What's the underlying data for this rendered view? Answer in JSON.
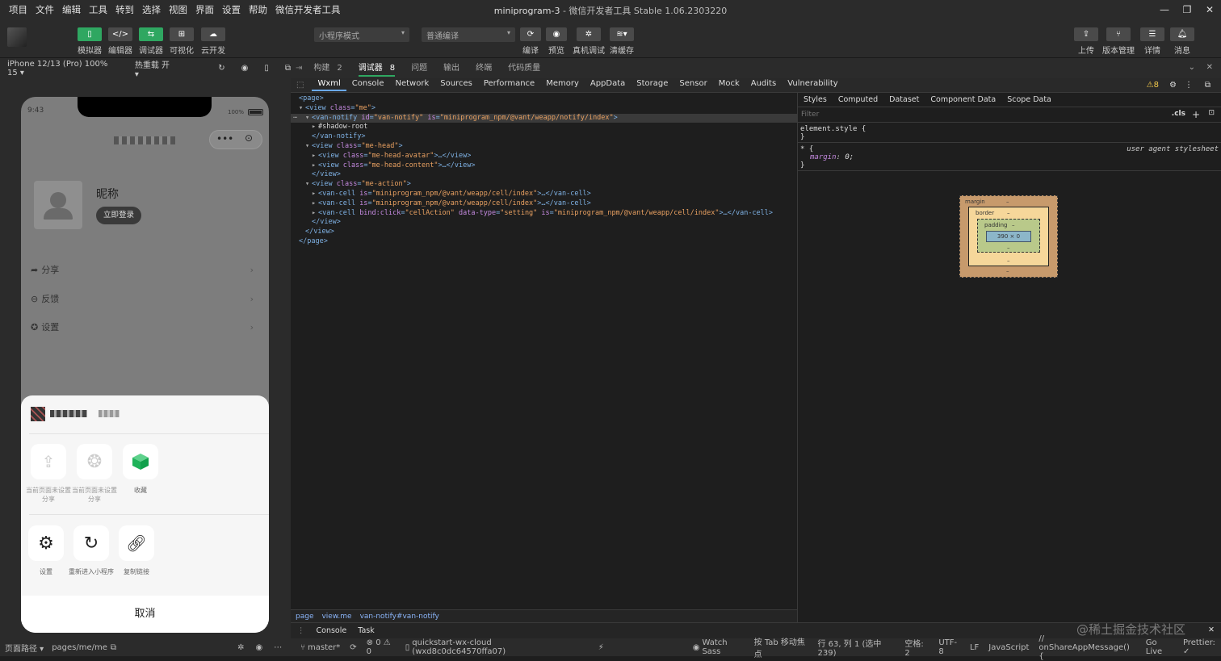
{
  "menubar": {
    "items": [
      "项目",
      "文件",
      "编辑",
      "工具",
      "转到",
      "选择",
      "视图",
      "界面",
      "设置",
      "帮助",
      "微信开发者工具"
    ],
    "project": "miniprogram-3",
    "app_title": " - 微信开发者工具 Stable 1.06.2303220"
  },
  "toolbar": {
    "left_buttons": [
      {
        "label": "模拟器",
        "icon": "phone-icon"
      },
      {
        "label": "编辑器",
        "icon": "code-icon"
      },
      {
        "label": "调试器",
        "icon": "debug-icon"
      },
      {
        "label": "可视化",
        "icon": "layout-icon"
      },
      {
        "label": "云开发",
        "icon": "cloud-icon"
      }
    ],
    "mode_select": "小程序模式",
    "compile_select": "普通编译",
    "center_buttons": [
      {
        "label": "编译",
        "icon": "refresh-icon"
      },
      {
        "label": "预览",
        "icon": "eye-icon"
      },
      {
        "label": "真机调试",
        "icon": "bug-icon"
      },
      {
        "label": "清缓存",
        "icon": "layers-icon"
      }
    ],
    "right_buttons": [
      {
        "label": "上传",
        "icon": "upload-icon"
      },
      {
        "label": "版本管理",
        "icon": "branch-icon"
      },
      {
        "label": "详情",
        "icon": "menu-icon"
      },
      {
        "label": "消息",
        "icon": "bell-icon"
      }
    ]
  },
  "devicebar": {
    "device": "iPhone 12/13 (Pro) 100% 15 ▾",
    "hotreload": "热重载 开 ▾"
  },
  "phone": {
    "time": "9:43",
    "battery": "100%",
    "nickname": "昵称",
    "login_button": "立即登录",
    "menu": [
      {
        "label": "分享",
        "icon": "share-icon"
      },
      {
        "label": "反馈",
        "icon": "feedback-icon"
      },
      {
        "label": "设置",
        "icon": "gear-icon"
      }
    ],
    "share_row1": [
      {
        "label": "当前页面未设置分享",
        "icon": "upload-icon"
      },
      {
        "label": "当前页面未设置分享",
        "icon": "aperture-icon"
      },
      {
        "label": "收藏",
        "icon": "cube-icon"
      }
    ],
    "share_row2": [
      {
        "label": "设置",
        "icon": "gear-icon"
      },
      {
        "label": "重新进入小程序",
        "icon": "reload-icon"
      },
      {
        "label": "复制链接",
        "icon": "link-icon"
      }
    ],
    "cancel": "取消"
  },
  "leftstatus": {
    "path_label": "页面路径 ▾",
    "path": "pages/me/me"
  },
  "devtabs1": {
    "items": [
      {
        "label": "构建",
        "count": "2"
      },
      {
        "label": "调试器",
        "count": "8"
      },
      {
        "label": "问题",
        "count": ""
      },
      {
        "label": "输出",
        "count": ""
      },
      {
        "label": "终端",
        "count": ""
      },
      {
        "label": "代码质量",
        "count": ""
      }
    ]
  },
  "devtabs2": {
    "items": [
      "Wxml",
      "Console",
      "Network",
      "Sources",
      "Performance",
      "Memory",
      "AppData",
      "Storage",
      "Sensor",
      "Mock",
      "Audits",
      "Vulnerability"
    ],
    "warnings": "⚠8"
  },
  "code": {
    "lines": [
      {
        "indent": 0,
        "arrow": "",
        "parts": [
          [
            "tag",
            "<page>"
          ]
        ]
      },
      {
        "indent": 1,
        "arrow": "▾",
        "parts": [
          [
            "tag",
            "<view "
          ],
          [
            "attr",
            "class"
          ],
          [
            "tag",
            "="
          ],
          [
            "val",
            "\"me\""
          ],
          [
            "tag",
            ">"
          ]
        ]
      },
      {
        "indent": 2,
        "arrow": "▾",
        "sel": true,
        "parts": [
          [
            "tag",
            "<van-notify "
          ],
          [
            "attr",
            "id"
          ],
          [
            "tag",
            "="
          ],
          [
            "val",
            "\"van-notify\""
          ],
          [
            "tag",
            " "
          ],
          [
            "attr",
            "is"
          ],
          [
            "tag",
            "="
          ],
          [
            "val",
            "\"miniprogram_npm/@vant/weapp/notify/index\""
          ],
          [
            "tag",
            ">"
          ]
        ]
      },
      {
        "indent": 3,
        "arrow": "▸",
        "parts": [
          [
            "txt",
            "#shadow-root"
          ]
        ]
      },
      {
        "indent": 2,
        "arrow": "",
        "parts": [
          [
            "tag",
            "</van-notify>"
          ]
        ]
      },
      {
        "indent": 2,
        "arrow": "▾",
        "parts": [
          [
            "tag",
            "<view "
          ],
          [
            "attr",
            "class"
          ],
          [
            "tag",
            "="
          ],
          [
            "val",
            "\"me-head\""
          ],
          [
            "tag",
            ">"
          ]
        ]
      },
      {
        "indent": 3,
        "arrow": "▸",
        "parts": [
          [
            "tag",
            "<view "
          ],
          [
            "attr",
            "class"
          ],
          [
            "tag",
            "="
          ],
          [
            "val",
            "\"me-head-avatar\""
          ],
          [
            "tag",
            ">…</view>"
          ]
        ]
      },
      {
        "indent": 3,
        "arrow": "▸",
        "parts": [
          [
            "tag",
            "<view "
          ],
          [
            "attr",
            "class"
          ],
          [
            "tag",
            "="
          ],
          [
            "val",
            "\"me-head-content\""
          ],
          [
            "tag",
            ">…</view>"
          ]
        ]
      },
      {
        "indent": 2,
        "arrow": "",
        "parts": [
          [
            "tag",
            "</view>"
          ]
        ]
      },
      {
        "indent": 2,
        "arrow": "▾",
        "parts": [
          [
            "tag",
            "<view "
          ],
          [
            "attr",
            "class"
          ],
          [
            "tag",
            "="
          ],
          [
            "val",
            "\"me-action\""
          ],
          [
            "tag",
            ">"
          ]
        ]
      },
      {
        "indent": 3,
        "arrow": "▸",
        "parts": [
          [
            "tag",
            "<van-cell "
          ],
          [
            "attr",
            "is"
          ],
          [
            "tag",
            "="
          ],
          [
            "val",
            "\"miniprogram_npm/@vant/weapp/cell/index\""
          ],
          [
            "tag",
            ">…</van-cell>"
          ]
        ]
      },
      {
        "indent": 3,
        "arrow": "▸",
        "parts": [
          [
            "tag",
            "<van-cell "
          ],
          [
            "attr",
            "is"
          ],
          [
            "tag",
            "="
          ],
          [
            "val",
            "\"miniprogram_npm/@vant/weapp/cell/index\""
          ],
          [
            "tag",
            ">…</van-cell>"
          ]
        ]
      },
      {
        "indent": 3,
        "arrow": "▸",
        "parts": [
          [
            "tag",
            "<van-cell "
          ],
          [
            "attr",
            "bind:click"
          ],
          [
            "tag",
            "="
          ],
          [
            "val",
            "\"cellAction\""
          ],
          [
            "tag",
            " "
          ],
          [
            "attr",
            "data-type"
          ],
          [
            "tag",
            "="
          ],
          [
            "val",
            "\"setting\""
          ],
          [
            "tag",
            " "
          ],
          [
            "attr",
            "is"
          ],
          [
            "tag",
            "="
          ],
          [
            "val",
            "\"miniprogram_npm/@vant/weapp/cell/index\""
          ],
          [
            "tag",
            ">…</van-cell>"
          ]
        ]
      },
      {
        "indent": 2,
        "arrow": "",
        "parts": [
          [
            "tag",
            "</view>"
          ]
        ]
      },
      {
        "indent": 1,
        "arrow": "",
        "parts": [
          [
            "tag",
            "</view>"
          ]
        ]
      },
      {
        "indent": 0,
        "arrow": "",
        "parts": [
          [
            "tag",
            "</page>"
          ]
        ]
      }
    ]
  },
  "breadcrumb": [
    "page",
    "view.me",
    "van-notify#van-notify"
  ],
  "sidebar": {
    "tabs": [
      "Styles",
      "Computed",
      "Dataset",
      "Component Data",
      "Scope Data"
    ],
    "filter_placeholder": "Filter",
    "cls": ".cls",
    "element_style": "element.style {",
    "close_brace": "}",
    "ua_selector": "* {",
    "ua_label": "user agent stylesheet",
    "ua_prop": "margin",
    "ua_value": "0;",
    "box": {
      "margin": "margin",
      "border": "border",
      "padding": "padding",
      "content": "390 × 0",
      "dash": "–"
    }
  },
  "drawer": {
    "tabs": [
      "Console",
      "Task"
    ]
  },
  "statusbar": {
    "branch": "master*",
    "errors": "⊗ 0 ⚠ 0",
    "cloud": "quickstart-wx-cloud (wxd8c0dc64570ffa07)",
    "watch_sass": "Watch Sass",
    "tab_focus": "按 Tab 移动焦点",
    "position": "行 63, 列 1 (选中 239)",
    "spaces": "空格: 2",
    "encoding": "UTF-8",
    "eol": "LF",
    "language": "JavaScript",
    "function": "// onShareAppMessage() {",
    "golive": "Go Live",
    "prettier": "Prettier: ✓"
  },
  "watermark": "@稀土掘金技术社区"
}
